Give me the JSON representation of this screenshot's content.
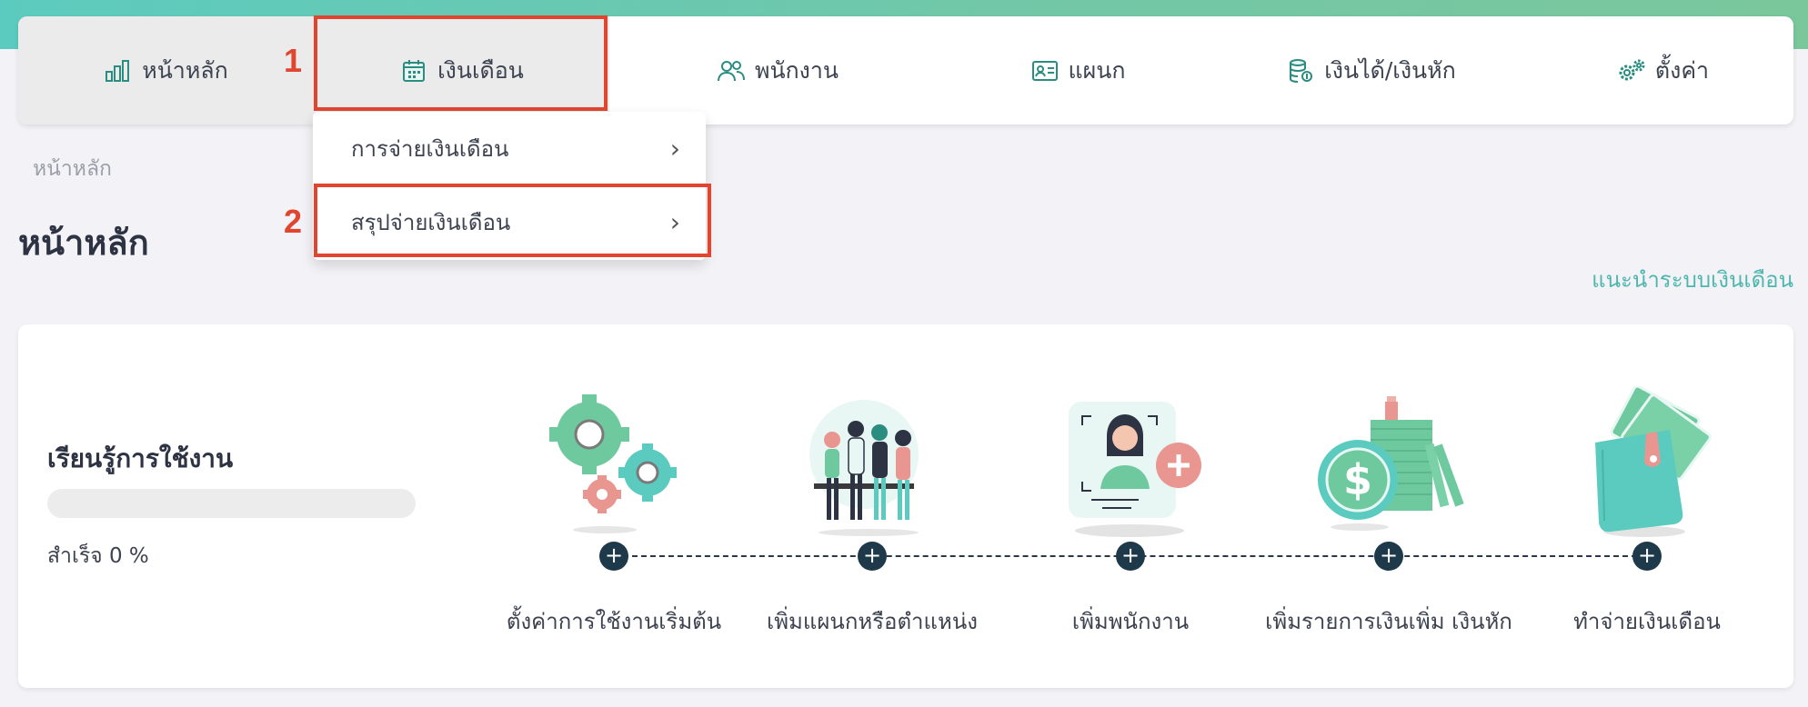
{
  "nav": {
    "home": "หน้าหลัก",
    "salary": "เงินเดือน",
    "employees": "พนักงาน",
    "department": "แผนก",
    "earnings_deductions": "เงินได้/เงินหัก",
    "settings": "ตั้งค่า"
  },
  "annotations": {
    "num1": "1",
    "num2": "2"
  },
  "dropdown": {
    "item1": "การจ่ายเงินเดือน",
    "item2": "สรุปจ่ายเงินเดือน",
    "chevron": "›"
  },
  "breadcrumb": "หน้าหลัก",
  "page_title": "หน้าหลัก",
  "guide_link": "แนะนำระบบเงินเดือน",
  "learning": {
    "title": "เรียนรู้การใช้งาน",
    "progress_percent": 0,
    "progress_text": "สำเร็จ 0 %"
  },
  "steps": [
    {
      "label": "ตั้งค่าการใช้งานเริ่มต้น",
      "button": "+"
    },
    {
      "label": "เพิ่มแผนกหรือตำแหน่ง",
      "button": "+"
    },
    {
      "label": "เพิ่มพนักงาน",
      "button": "+"
    },
    {
      "label": "เพิ่มรายการเงินเพิ่ม เงินหัก",
      "button": "+"
    },
    {
      "label": "ทำจ่ายเงินเดือน",
      "button": "+"
    }
  ],
  "colors": {
    "accent": "#5ccbbf",
    "highlight": "#e2452f",
    "link": "#4fb6ae",
    "step_button": "#1e3a4a"
  },
  "icons": {
    "home": "bar-chart-icon",
    "salary": "calendar-icon",
    "employees": "users-icon",
    "department": "id-card-icon",
    "earnings": "coins-icon",
    "settings": "gears-icon",
    "chevron": "chevron-right-icon",
    "step": "plus-icon"
  }
}
